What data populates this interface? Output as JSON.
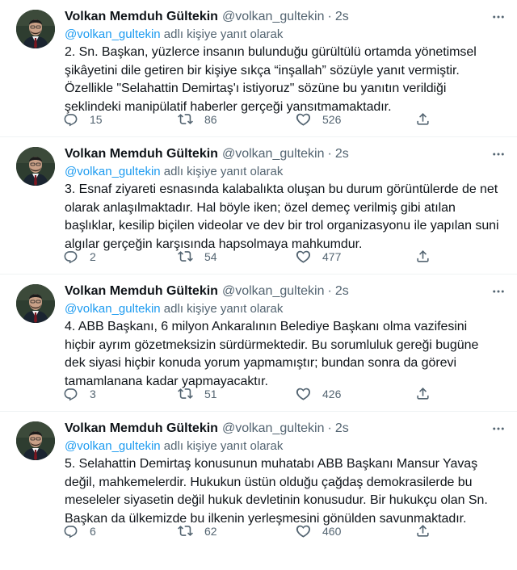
{
  "author": {
    "name": "Volkan Memduh Gültekin",
    "handle": "@volkan_gultekin",
    "separator": "·",
    "time": "2s"
  },
  "reply_context": {
    "mention": "@volkan_gultekin",
    "suffix": " adlı kişiye yanıt olarak"
  },
  "icons": {
    "reply": "reply-icon",
    "retweet": "retweet-icon",
    "like": "heart-icon",
    "share": "share-icon",
    "more": "more-icon"
  },
  "colors": {
    "link": "#1d9bf0",
    "muted": "#536471",
    "text": "#0f1419"
  },
  "tweets": [
    {
      "lines": [
        "2. Sn. Başkan, yüzlerce insanın bulunduğu gürültülü ortamda yönetimsel",
        "şikâyetini dile getiren bir kişiye sıkça “inşallah” sözüyle yanıt vermiştir.",
        "Özellikle \"Selahattin Demirtaş'ı istiyoruz\" sözüne bu yanıtın verildiği",
        "şeklindeki manipülatif haberler gerçeği yansıtmamaktadır."
      ],
      "replies": "15",
      "retweets": "86",
      "likes": "526"
    },
    {
      "lines": [
        "3. Esnaf ziyareti esnasında kalabalıkta oluşan bu durum görüntülerde de net",
        "olarak anlaşılmaktadır. Hal böyle iken; özel demeç verilmiş gibi atılan",
        "başlıklar, kesilip biçilen videolar ve dev bir trol organizasyonu ile yapılan suni",
        "algılar gerçeğin karşısında hapsolmaya mahkumdur."
      ],
      "replies": "2",
      "retweets": "54",
      "likes": "477"
    },
    {
      "lines": [
        "4. ABB Başkanı, 6 milyon Ankaralının Belediye Başkanı olma vazifesini",
        "hiçbir ayrım gözetmeksizin sürdürmektedir. Bu sorumluluk gereği bugüne",
        "dek siyasi hiçbir konuda yorum yapmamıştır; bundan sonra da görevi",
        "tamamlanana kadar yapmayacaktır."
      ],
      "replies": "3",
      "retweets": "51",
      "likes": "426"
    },
    {
      "lines": [
        "5. Selahattin Demirtaş konusunun muhatabı ABB Başkanı Mansur Yavaş",
        "değil, mahkemelerdir. Hukukun üstün olduğu çağdaş demokrasilerde bu",
        "meseleler siyasetin değil hukuk devletinin konusudur. Bir hukukçu olan Sn.",
        "Başkan da ülkemizde bu ilkenin yerleşmesini gönülden savunmaktadır."
      ],
      "replies": "6",
      "retweets": "62",
      "likes": "460"
    }
  ]
}
